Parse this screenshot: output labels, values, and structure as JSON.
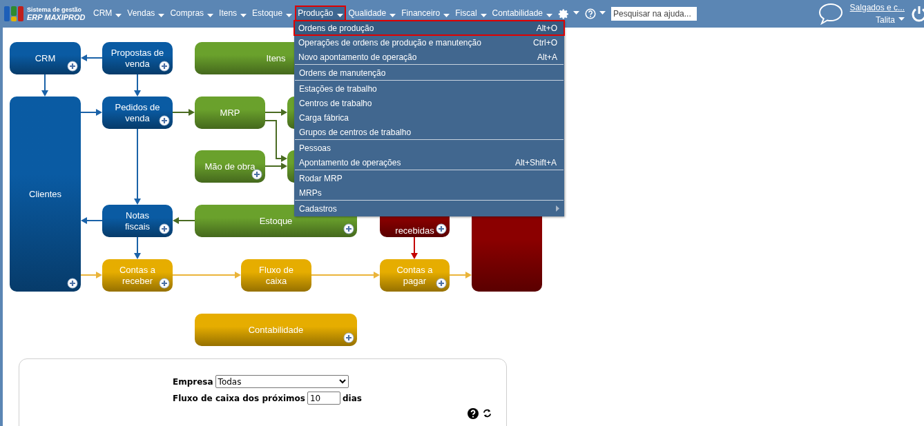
{
  "header": {
    "brand": {
      "line1": "Sistema de gestão",
      "line2": "ERP MAXIPROD"
    },
    "menu": [
      {
        "label": "CRM",
        "selected": false
      },
      {
        "label": "Vendas",
        "selected": false
      },
      {
        "label": "Compras",
        "selected": false
      },
      {
        "label": "Itens",
        "selected": false
      },
      {
        "label": "Estoque",
        "selected": false
      },
      {
        "label": "Produção",
        "selected": true
      },
      {
        "label": "Qualidade",
        "selected": false
      },
      {
        "label": "Financeiro",
        "selected": false
      },
      {
        "label": "Fiscal",
        "selected": false
      },
      {
        "label": "Contabilidade",
        "selected": false
      }
    ],
    "search": {
      "placeholder": "Pesquisar na ajuda..."
    },
    "company": "Salgados e c...",
    "user": "Talita"
  },
  "dropdown": {
    "groups": [
      [
        {
          "label": "Ordens de produção",
          "shortcut": "Alt+O",
          "selected": true,
          "kind": "item"
        },
        {
          "label": "Operações de ordens de produção e manutenção",
          "shortcut": "Ctrl+O",
          "selected": false,
          "kind": "item"
        },
        {
          "label": "Novo apontamento de operação",
          "shortcut": "Alt+A",
          "selected": false,
          "kind": "item"
        }
      ],
      [
        {
          "label": "Ordens de manutenção",
          "selected": false,
          "kind": "item"
        }
      ],
      [
        {
          "label": "Estações de trabalho",
          "selected": false,
          "kind": "item"
        },
        {
          "label": "Centros de trabalho",
          "selected": false,
          "kind": "item"
        },
        {
          "label": "Carga fábrica",
          "selected": false,
          "kind": "item"
        },
        {
          "label": "Grupos de centros de trabalho",
          "selected": false,
          "kind": "item"
        }
      ],
      [
        {
          "label": "Pessoas",
          "selected": false,
          "kind": "item"
        },
        {
          "label": "Apontamento de operações",
          "shortcut": "Alt+Shift+A",
          "selected": false,
          "kind": "item"
        }
      ],
      [
        {
          "label": "Rodar MRP",
          "selected": false,
          "kind": "item"
        },
        {
          "label": "MRPs",
          "selected": false,
          "kind": "item"
        }
      ],
      [
        {
          "label": "Cadastros",
          "selected": false,
          "kind": "submenu"
        }
      ]
    ]
  },
  "diagram": {
    "nodes": [
      {
        "label": "CRM",
        "color": "#0a5ba3",
        "plus": true
      },
      {
        "label": "Propostas de\nvenda",
        "color": "#0a5ba3",
        "plus": true
      },
      {
        "label": "Itens",
        "color": "#6aa12c"
      },
      {
        "label": "Clientes",
        "color": "#0a5ba3",
        "plus": true
      },
      {
        "label": "Pedidos de\nvenda",
        "color": "#0a5ba3",
        "plus": true
      },
      {
        "label": "MRP",
        "color": "#6aa12c",
        "plus": false
      },
      {
        "color": "#6aa12c"
      },
      {
        "label": "Mão de obra",
        "color": "#6aa12c",
        "plus": true
      },
      {
        "color": "#6aa12c"
      },
      {
        "label": "Notas\nfiscais",
        "color": "#0a5ba3",
        "plus": true
      },
      {
        "label": "Estoque",
        "color": "#6aa12c",
        "plus": true
      },
      {
        "label": "recebidas",
        "color": "#8b0000",
        "plus": true
      },
      {
        "color": "#8b0000",
        "plus": false
      },
      {
        "label": "Contas a\nreceber",
        "color": "#e6ad00",
        "plus": true
      },
      {
        "label": "Fluxo de\ncaixa",
        "color": "#e6ad00",
        "plus": false
      },
      {
        "label": "Contas a\npagar",
        "color": "#e6ad00",
        "plus": true
      },
      {
        "label": "Contabilidade",
        "color": "#e6ad00",
        "plus": true
      }
    ]
  },
  "form": {
    "fields": [
      {
        "label": "Empresa",
        "kind": "select",
        "value": "Todas"
      },
      {
        "label": "Fluxo de caixa dos próximos",
        "kind": "number",
        "value": "10",
        "suffix": "dias"
      }
    ]
  }
}
